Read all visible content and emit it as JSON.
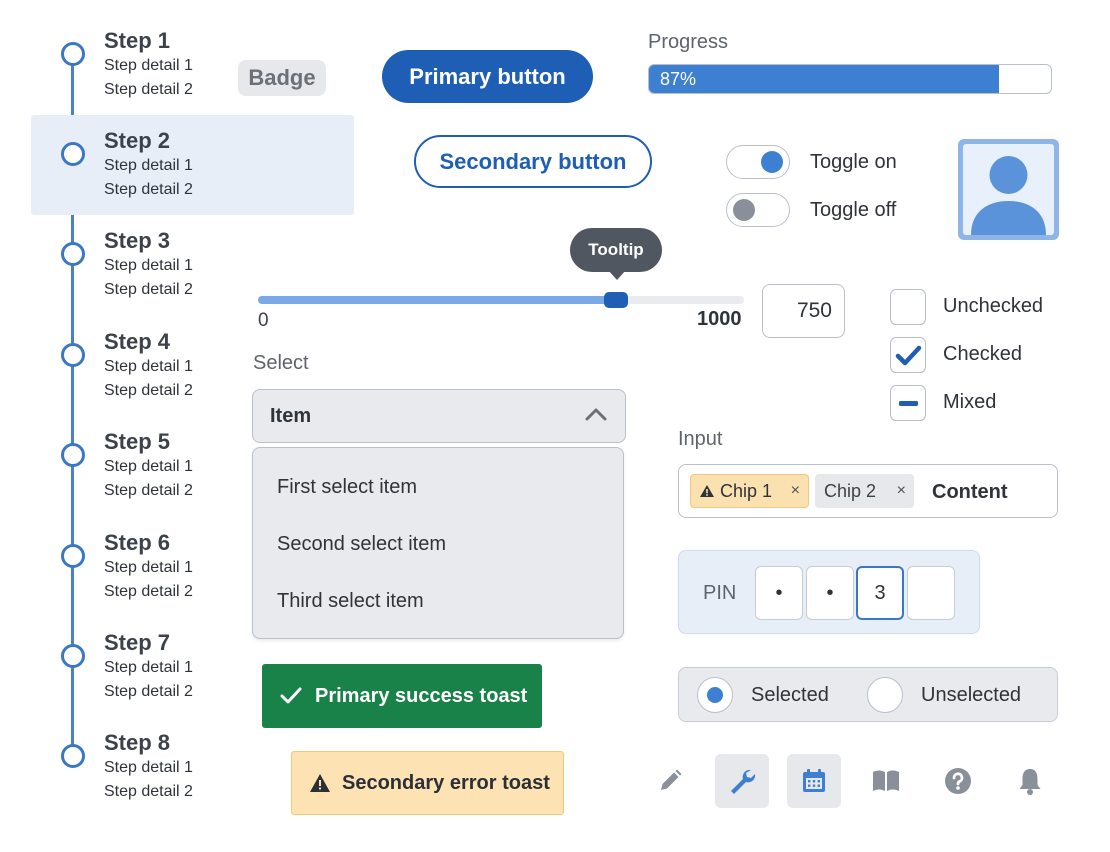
{
  "stepper": {
    "steps": [
      {
        "title": "Step 1",
        "detail1": "Step detail 1",
        "detail2": "Step detail 2"
      },
      {
        "title": "Step 2",
        "detail1": "Step detail 1",
        "detail2": "Step detail 2",
        "active": true
      },
      {
        "title": "Step 3",
        "detail1": "Step detail 1",
        "detail2": "Step detail 2"
      },
      {
        "title": "Step 4",
        "detail1": "Step detail 1",
        "detail2": "Step detail 2"
      },
      {
        "title": "Step 5",
        "detail1": "Step detail 1",
        "detail2": "Step detail 2"
      },
      {
        "title": "Step 6",
        "detail1": "Step detail 1",
        "detail2": "Step detail 2"
      },
      {
        "title": "Step 7",
        "detail1": "Step detail 1",
        "detail2": "Step detail 2"
      },
      {
        "title": "Step 8",
        "detail1": "Step detail 1",
        "detail2": "Step detail 2"
      }
    ]
  },
  "badge": {
    "label": "Badge"
  },
  "buttons": {
    "primary": "Primary button",
    "secondary": "Secondary button"
  },
  "progress": {
    "label": "Progress",
    "value_text": "87%",
    "fraction": 0.87
  },
  "toggles": {
    "on_label": "Toggle on",
    "off_label": "Toggle off"
  },
  "avatar": {
    "icon": "user-avatar-icon"
  },
  "slider": {
    "tooltip": "Tooltip",
    "min": "0",
    "max": "1000",
    "value": "750",
    "fraction": 0.75
  },
  "checkboxes": {
    "unchecked": "Unchecked",
    "checked": "Checked",
    "mixed": "Mixed"
  },
  "select": {
    "label": "Select",
    "value": "Item",
    "options": [
      "First select item",
      "Second select item",
      "Third select item"
    ]
  },
  "input": {
    "label": "Input",
    "chips": [
      {
        "label": "Chip 1",
        "icon": "warning-icon"
      },
      {
        "label": "Chip 2"
      }
    ],
    "chip_remove": "×",
    "content": "Content"
  },
  "pin": {
    "label": "PIN",
    "cells": [
      "•",
      "•",
      "3",
      ""
    ]
  },
  "radio": {
    "selected": "Selected",
    "unselected": "Unselected"
  },
  "toasts": {
    "success": "Primary success toast",
    "error": "Secondary error toast"
  },
  "toolbar": {
    "icons": [
      "pencil-icon",
      "wrench-icon",
      "calendar-icon",
      "book-icon",
      "help-icon",
      "bell-icon"
    ],
    "active": [
      "wrench-icon",
      "calendar-icon"
    ]
  },
  "colors": {
    "accent": "#1f5eb5",
    "accent_light": "#3d7fd1",
    "success": "#198249",
    "warning": "#fde3b4",
    "panel": "#e9eaed"
  }
}
